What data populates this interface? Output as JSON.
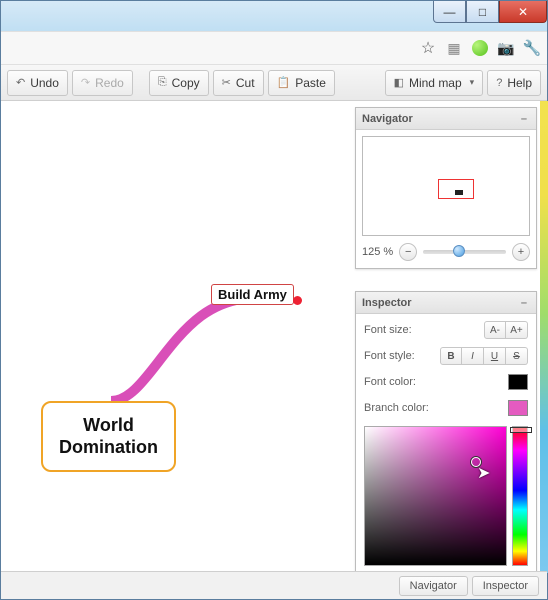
{
  "window_buttons": {
    "min": "—",
    "max": "□",
    "close": "✕"
  },
  "addr_icons": {
    "star": "☆",
    "grid": "▦",
    "camera": "📷",
    "wrench": "🔧"
  },
  "toolbar": {
    "undo": {
      "icon": "↶",
      "label": "Undo"
    },
    "redo": {
      "icon": "↷",
      "label": "Redo"
    },
    "copy": {
      "icon": "⎘",
      "label": "Copy"
    },
    "cut": {
      "icon": "✂",
      "label": "Cut"
    },
    "paste": {
      "icon": "📋",
      "label": "Paste"
    },
    "mindmap": {
      "icon": "◧",
      "label": "Mind map",
      "caret": "▾"
    },
    "help": {
      "icon": "?",
      "label": "Help"
    }
  },
  "navigator": {
    "title": "Navigator",
    "collapse": "–",
    "zoom": "125 %",
    "zoom_out": "−",
    "zoom_in": "+"
  },
  "inspector": {
    "title": "Inspector",
    "collapse": "–",
    "font_size_label": "Font size:",
    "font_size_dec": "A-",
    "font_size_inc": "A+",
    "font_style_label": "Font style:",
    "bold": "B",
    "italic": "I",
    "underline": "U",
    "strike": "S",
    "font_color_label": "Font color:",
    "branch_color_label": "Branch color:",
    "font_color": "#000000",
    "branch_color": "#e45bc0"
  },
  "mindmap": {
    "root": "World\nDomination",
    "child": "Build Army"
  },
  "status": {
    "navigator": "Navigator",
    "inspector": "Inspector"
  }
}
